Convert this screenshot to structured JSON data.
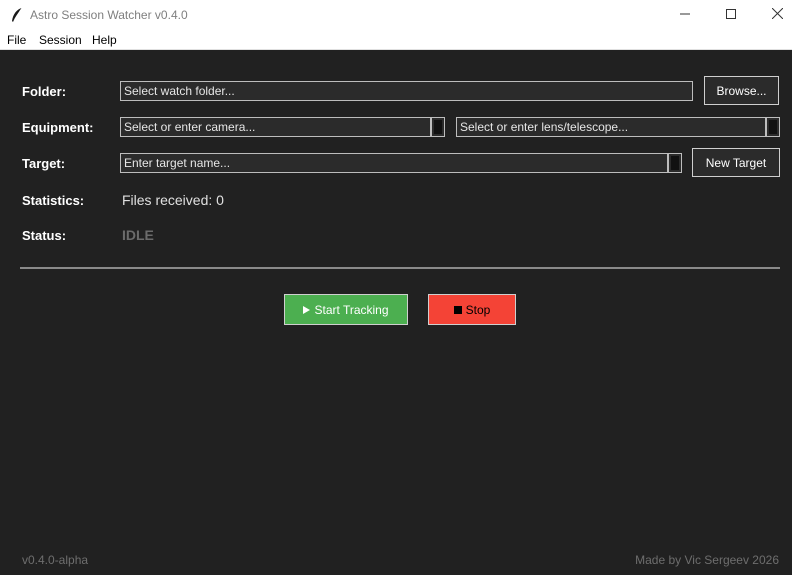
{
  "window": {
    "title": "Astro Session Watcher v0.4.0"
  },
  "menu": {
    "file": "File",
    "session": "Session",
    "help": "Help"
  },
  "form": {
    "folder_label": "Folder:",
    "folder_placeholder": "Select watch folder...",
    "browse_label": "Browse...",
    "equipment_label": "Equipment:",
    "camera_placeholder": "Select or enter camera...",
    "lens_placeholder": "Select or enter lens/telescope...",
    "target_label": "Target:",
    "target_placeholder": "Enter target name...",
    "new_target_label": "New Target",
    "statistics_label": "Statistics:",
    "files_received": "Files received: 0",
    "status_label": "Status:",
    "status_value": "IDLE"
  },
  "actions": {
    "start_label": "Start Tracking",
    "start_icon": "play-icon",
    "start_color": "#4caf50",
    "stop_label": "Stop",
    "stop_icon": "stop-square-icon",
    "stop_color": "#f44336"
  },
  "footer": {
    "version": "v0.4.0-alpha",
    "credit": "Made by Vic Sergeev 2026"
  }
}
